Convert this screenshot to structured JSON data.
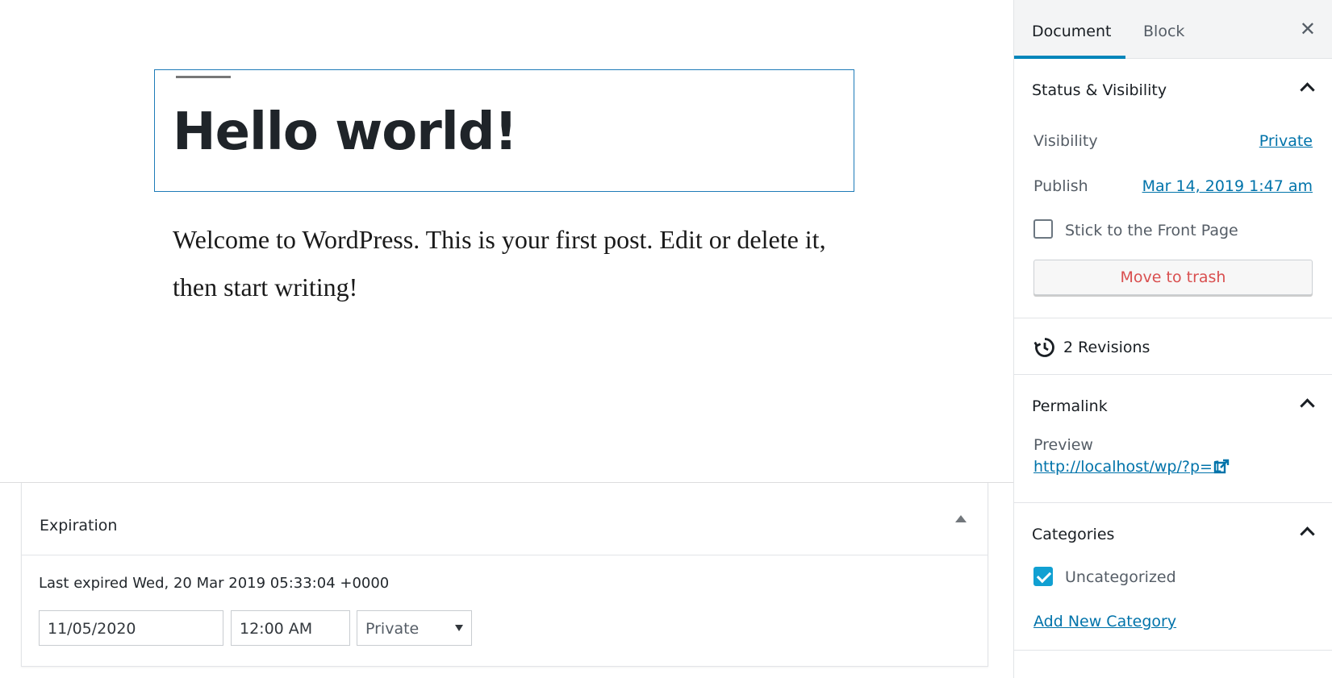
{
  "editor": {
    "post_title": "Hello world!",
    "post_body": "Welcome to WordPress. This is your first post. Edit or delete it, then start writing!"
  },
  "metabox": {
    "title": "Expiration",
    "last_expired": "Last expired Wed, 20 Mar 2019 05:33:04 +0000",
    "date_value": "11/05/2020",
    "time_value": "12:00  AM",
    "status_value": "Private"
  },
  "sidebar": {
    "tabs": {
      "document": "Document",
      "block": "Block"
    },
    "close_icon": "close-icon",
    "status_visibility": {
      "title": "Status & Visibility",
      "visibility_label": "Visibility",
      "visibility_value": "Private",
      "publish_label": "Publish",
      "publish_value": "Mar 14, 2019 1:47 am",
      "stick_label": "Stick to the Front Page",
      "stick_checked": false,
      "trash_label": "Move to trash"
    },
    "revisions": {
      "label": "2 Revisions",
      "icon": "history-icon"
    },
    "permalink": {
      "title": "Permalink",
      "preview_label": "Preview",
      "url": "http://localhost/wp/?p=1",
      "icon": "external-link-icon"
    },
    "categories": {
      "title": "Categories",
      "items": [
        {
          "label": "Uncategorized",
          "checked": true
        }
      ],
      "add_new": "Add New Category"
    }
  },
  "colors": {
    "accent": "#0085ba",
    "link": "#0073aa",
    "danger": "#d94f4f",
    "selection_border": "#1e7bb8"
  }
}
